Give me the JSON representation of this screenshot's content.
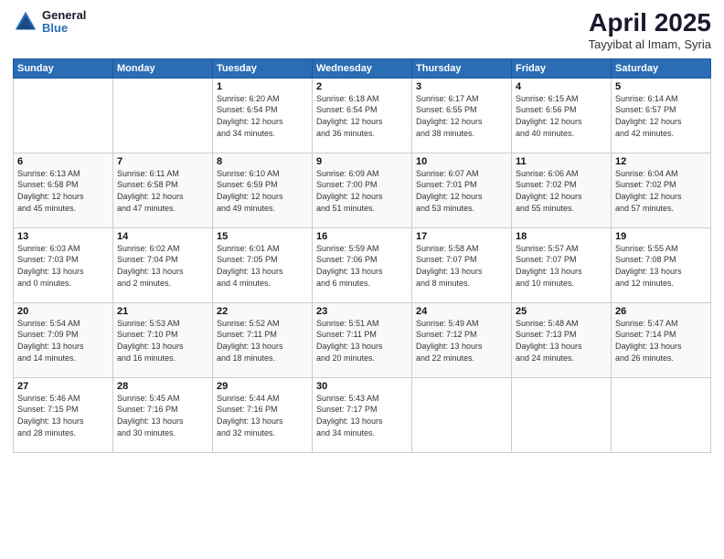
{
  "logo": {
    "general": "General",
    "blue": "Blue"
  },
  "title": "April 2025",
  "subtitle": "Tayyibat al Imam, Syria",
  "days_header": [
    "Sunday",
    "Monday",
    "Tuesday",
    "Wednesday",
    "Thursday",
    "Friday",
    "Saturday"
  ],
  "weeks": [
    [
      {
        "day": "",
        "info": ""
      },
      {
        "day": "",
        "info": ""
      },
      {
        "day": "1",
        "info": "Sunrise: 6:20 AM\nSunset: 6:54 PM\nDaylight: 12 hours\nand 34 minutes."
      },
      {
        "day": "2",
        "info": "Sunrise: 6:18 AM\nSunset: 6:54 PM\nDaylight: 12 hours\nand 36 minutes."
      },
      {
        "day": "3",
        "info": "Sunrise: 6:17 AM\nSunset: 6:55 PM\nDaylight: 12 hours\nand 38 minutes."
      },
      {
        "day": "4",
        "info": "Sunrise: 6:15 AM\nSunset: 6:56 PM\nDaylight: 12 hours\nand 40 minutes."
      },
      {
        "day": "5",
        "info": "Sunrise: 6:14 AM\nSunset: 6:57 PM\nDaylight: 12 hours\nand 42 minutes."
      }
    ],
    [
      {
        "day": "6",
        "info": "Sunrise: 6:13 AM\nSunset: 6:58 PM\nDaylight: 12 hours\nand 45 minutes."
      },
      {
        "day": "7",
        "info": "Sunrise: 6:11 AM\nSunset: 6:58 PM\nDaylight: 12 hours\nand 47 minutes."
      },
      {
        "day": "8",
        "info": "Sunrise: 6:10 AM\nSunset: 6:59 PM\nDaylight: 12 hours\nand 49 minutes."
      },
      {
        "day": "9",
        "info": "Sunrise: 6:09 AM\nSunset: 7:00 PM\nDaylight: 12 hours\nand 51 minutes."
      },
      {
        "day": "10",
        "info": "Sunrise: 6:07 AM\nSunset: 7:01 PM\nDaylight: 12 hours\nand 53 minutes."
      },
      {
        "day": "11",
        "info": "Sunrise: 6:06 AM\nSunset: 7:02 PM\nDaylight: 12 hours\nand 55 minutes."
      },
      {
        "day": "12",
        "info": "Sunrise: 6:04 AM\nSunset: 7:02 PM\nDaylight: 12 hours\nand 57 minutes."
      }
    ],
    [
      {
        "day": "13",
        "info": "Sunrise: 6:03 AM\nSunset: 7:03 PM\nDaylight: 13 hours\nand 0 minutes."
      },
      {
        "day": "14",
        "info": "Sunrise: 6:02 AM\nSunset: 7:04 PM\nDaylight: 13 hours\nand 2 minutes."
      },
      {
        "day": "15",
        "info": "Sunrise: 6:01 AM\nSunset: 7:05 PM\nDaylight: 13 hours\nand 4 minutes."
      },
      {
        "day": "16",
        "info": "Sunrise: 5:59 AM\nSunset: 7:06 PM\nDaylight: 13 hours\nand 6 minutes."
      },
      {
        "day": "17",
        "info": "Sunrise: 5:58 AM\nSunset: 7:07 PM\nDaylight: 13 hours\nand 8 minutes."
      },
      {
        "day": "18",
        "info": "Sunrise: 5:57 AM\nSunset: 7:07 PM\nDaylight: 13 hours\nand 10 minutes."
      },
      {
        "day": "19",
        "info": "Sunrise: 5:55 AM\nSunset: 7:08 PM\nDaylight: 13 hours\nand 12 minutes."
      }
    ],
    [
      {
        "day": "20",
        "info": "Sunrise: 5:54 AM\nSunset: 7:09 PM\nDaylight: 13 hours\nand 14 minutes."
      },
      {
        "day": "21",
        "info": "Sunrise: 5:53 AM\nSunset: 7:10 PM\nDaylight: 13 hours\nand 16 minutes."
      },
      {
        "day": "22",
        "info": "Sunrise: 5:52 AM\nSunset: 7:11 PM\nDaylight: 13 hours\nand 18 minutes."
      },
      {
        "day": "23",
        "info": "Sunrise: 5:51 AM\nSunset: 7:11 PM\nDaylight: 13 hours\nand 20 minutes."
      },
      {
        "day": "24",
        "info": "Sunrise: 5:49 AM\nSunset: 7:12 PM\nDaylight: 13 hours\nand 22 minutes."
      },
      {
        "day": "25",
        "info": "Sunrise: 5:48 AM\nSunset: 7:13 PM\nDaylight: 13 hours\nand 24 minutes."
      },
      {
        "day": "26",
        "info": "Sunrise: 5:47 AM\nSunset: 7:14 PM\nDaylight: 13 hours\nand 26 minutes."
      }
    ],
    [
      {
        "day": "27",
        "info": "Sunrise: 5:46 AM\nSunset: 7:15 PM\nDaylight: 13 hours\nand 28 minutes."
      },
      {
        "day": "28",
        "info": "Sunrise: 5:45 AM\nSunset: 7:16 PM\nDaylight: 13 hours\nand 30 minutes."
      },
      {
        "day": "29",
        "info": "Sunrise: 5:44 AM\nSunset: 7:16 PM\nDaylight: 13 hours\nand 32 minutes."
      },
      {
        "day": "30",
        "info": "Sunrise: 5:43 AM\nSunset: 7:17 PM\nDaylight: 13 hours\nand 34 minutes."
      },
      {
        "day": "",
        "info": ""
      },
      {
        "day": "",
        "info": ""
      },
      {
        "day": "",
        "info": ""
      }
    ]
  ]
}
